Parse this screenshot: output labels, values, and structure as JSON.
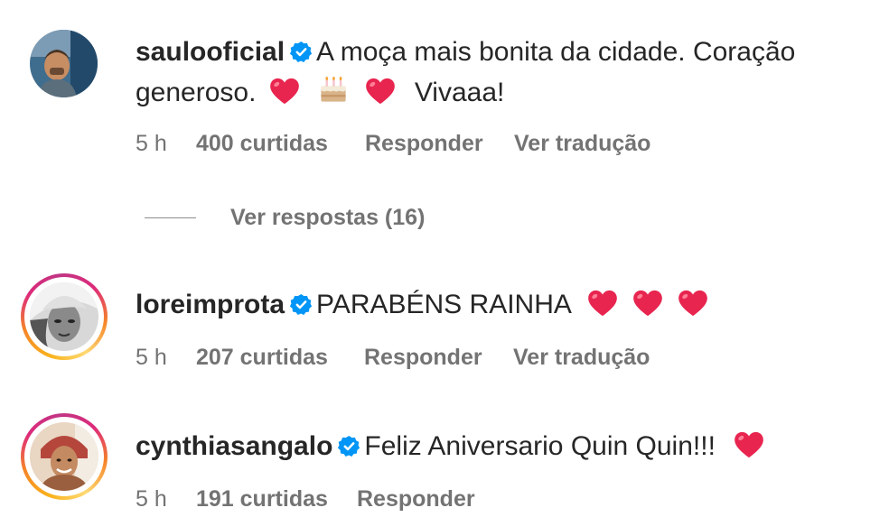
{
  "comments": [
    {
      "username": "saulooficial",
      "text_line1": "A moça mais bonita da cidade. Coração",
      "text_line2_start": "generoso.",
      "text_line2_end": "Vivaaa!",
      "time": "5 h",
      "likes": "400 curtidas",
      "reply_label": "Responder",
      "translate_label": "Ver tradução",
      "emojis": [
        "red-heart",
        "birthday-cake",
        "red-heart"
      ]
    },
    {
      "username": "loreimprota",
      "text": "PARABÉNS RAINHA",
      "time": "5 h",
      "likes": "207 curtidas",
      "reply_label": "Responder",
      "translate_label": "Ver tradução",
      "emojis": [
        "red-heart",
        "red-heart",
        "red-heart"
      ]
    },
    {
      "username": "cynthiasangalo",
      "text": "Feliz Aniversario Quin Quin!!!",
      "time": "5 h",
      "likes": "191 curtidas",
      "reply_label": "Responder",
      "emojis": [
        "red-heart"
      ]
    }
  ],
  "replies_toggle": {
    "label": "Ver respostas (16)"
  },
  "colors": {
    "text": "#262626",
    "secondary": "#737373",
    "verified": "#0095f6",
    "heart": "#e8254f"
  },
  "icons": [
    "verified-badge-icon",
    "red-heart-icon",
    "birthday-cake-icon"
  ]
}
